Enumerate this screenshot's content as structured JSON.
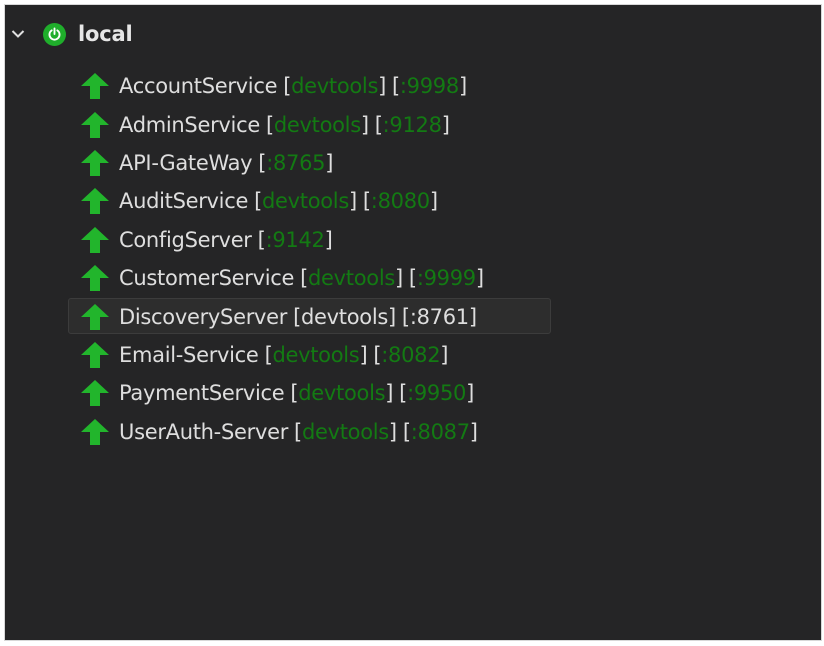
{
  "tree": {
    "root": {
      "label": "local",
      "expanded": true,
      "status_color": "#1fae2b"
    },
    "arrow_color": "#22b52c",
    "tag_color": "#137a13",
    "items": [
      {
        "name": "AccountService",
        "devtools": "devtools",
        "port": ":9998",
        "selected": false
      },
      {
        "name": "AdminService",
        "devtools": "devtools",
        "port": ":9128",
        "selected": false
      },
      {
        "name": "API-GateWay",
        "devtools": "",
        "port": ":8765",
        "selected": false
      },
      {
        "name": "AuditService",
        "devtools": "devtools",
        "port": ":8080",
        "selected": false
      },
      {
        "name": "ConfigServer",
        "devtools": "",
        "port": ":9142",
        "selected": false
      },
      {
        "name": "CustomerService",
        "devtools": "devtools",
        "port": ":9999",
        "selected": false
      },
      {
        "name": "DiscoveryServer",
        "devtools": "devtools",
        "port": ":8761",
        "selected": true
      },
      {
        "name": "Email-Service",
        "devtools": "devtools",
        "port": ":8082",
        "selected": false
      },
      {
        "name": "PaymentService",
        "devtools": "devtools",
        "port": ":9950",
        "selected": false
      },
      {
        "name": "UserAuth-Server",
        "devtools": "devtools",
        "port": ":8087",
        "selected": false
      }
    ]
  }
}
